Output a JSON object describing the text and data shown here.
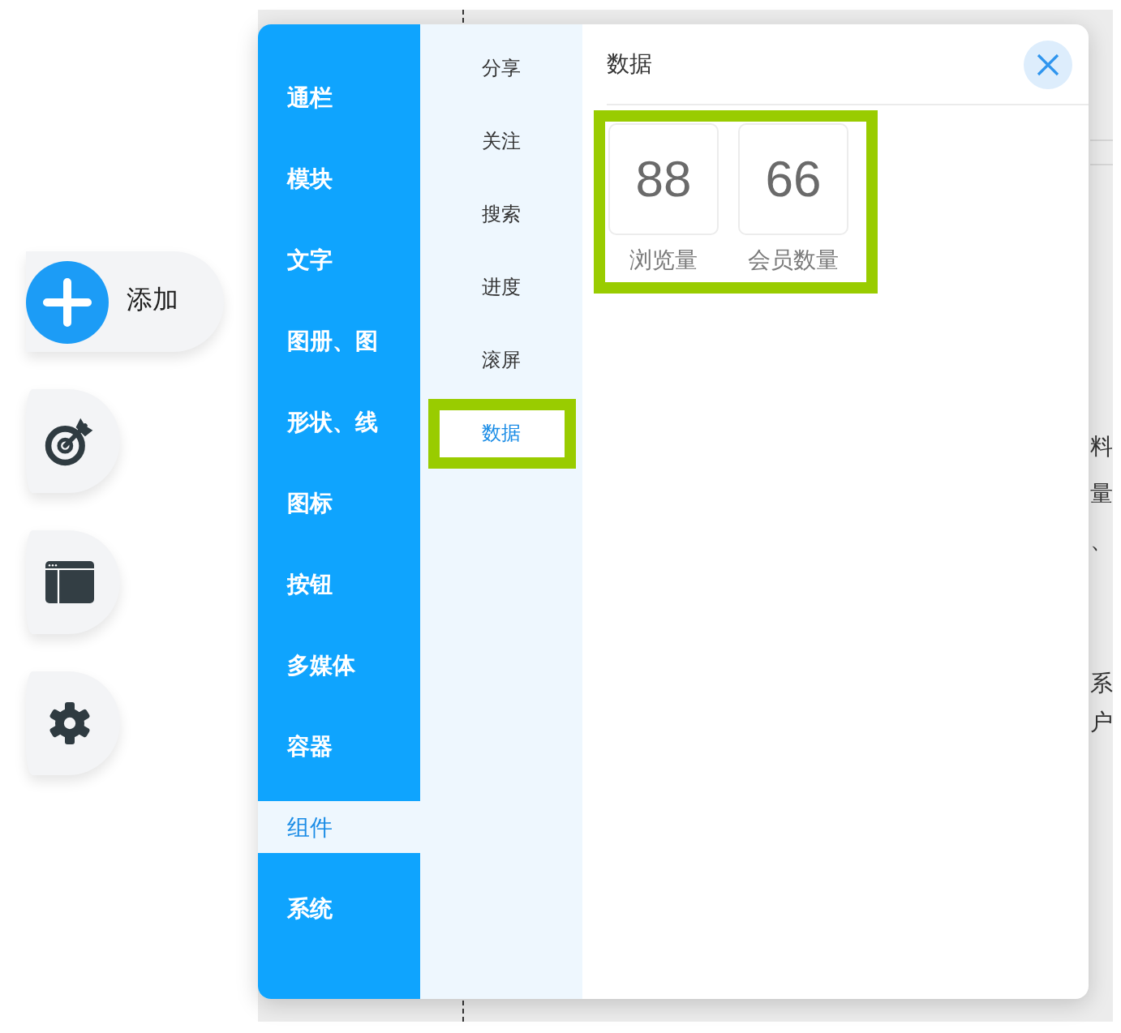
{
  "add_button": {
    "label": "添加"
  },
  "categories": [
    {
      "label": "通栏",
      "selected": false
    },
    {
      "label": "模块",
      "selected": false
    },
    {
      "label": "文字",
      "selected": false
    },
    {
      "label": "图册、图",
      "selected": false
    },
    {
      "label": "形状、线",
      "selected": false
    },
    {
      "label": "图标",
      "selected": false
    },
    {
      "label": "按钮",
      "selected": false
    },
    {
      "label": "多媒体",
      "selected": false
    },
    {
      "label": "容器",
      "selected": false
    },
    {
      "label": "组件",
      "selected": true
    },
    {
      "label": "系统",
      "selected": false
    }
  ],
  "subcategories": [
    {
      "label": "分享",
      "selected": false,
      "highlighted": false
    },
    {
      "label": "关注",
      "selected": false,
      "highlighted": false
    },
    {
      "label": "搜索",
      "selected": false,
      "highlighted": false
    },
    {
      "label": "进度",
      "selected": false,
      "highlighted": false
    },
    {
      "label": "滚屏",
      "selected": false,
      "highlighted": false
    },
    {
      "label": "数据",
      "selected": true,
      "highlighted": true
    }
  ],
  "content": {
    "title": "数据",
    "stats": {
      "highlighted": true,
      "items": [
        {
          "value": "88",
          "label": "浏览量"
        },
        {
          "value": "66",
          "label": "会员数量"
        }
      ]
    }
  },
  "background_text": [
    {
      "lines": [
        "料",
        "量",
        "、"
      ]
    },
    {
      "lines": [
        "系",
        "户"
      ]
    }
  ]
}
